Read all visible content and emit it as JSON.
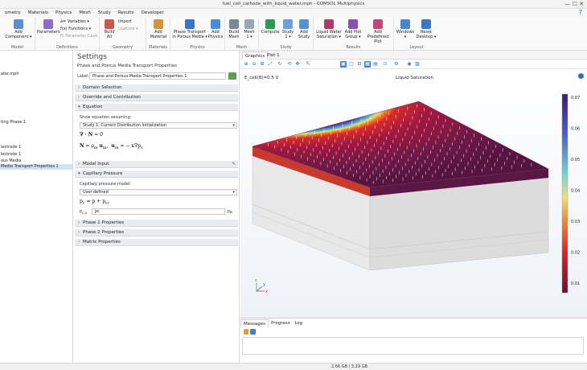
{
  "window": {
    "title": "fuel_cell_cathode_with_liquid_water.mph - COMSOL Multiphysics",
    "controls": "—  ☐  ✕"
  },
  "menu": [
    "ometry",
    "Materials",
    "Physics",
    "Mesh",
    "Study",
    "Results",
    "Developer"
  ],
  "help": "?",
  "ribbon": {
    "model": {
      "label": "Model",
      "component": "Add\nComponent ▾"
    },
    "definitions": {
      "label": "Definitions",
      "parameters": "Parameters",
      "variables": "a= Variables ▾",
      "functions": "f(x) Functions ▾",
      "param_case": "P| Parameter Case"
    },
    "geometry": {
      "label": "Geometry",
      "build_all": "Build\nAll",
      "import": "Import",
      "livelink": "LiveLink ▾"
    },
    "materials": {
      "label": "Materials",
      "add_material": "Add\nMaterial"
    },
    "physics": {
      "label": "Physics",
      "phase_transport": "Phase Transport\nin Porous Media ▾",
      "add_physics": "Add\nPhysics"
    },
    "mesh": {
      "label": "Mesh",
      "build_mesh": "Build\nMesh",
      "mesh1": "Mesh\n1 ▾"
    },
    "study": {
      "label": "Study",
      "compute": "Compute",
      "study1": "Study\n1 ▾",
      "add_study": "Add\nStudy"
    },
    "results": {
      "label": "Results",
      "liquid_water": "Liquid Water\nSaturation ▾",
      "add_plot": "Add Plot\nGroup ▾",
      "add_predef": "Add\nPredefined Plot"
    },
    "layout": {
      "label": "Layout",
      "windows": "Windows\n▾",
      "reset": "Reset\nDesktop ▾"
    }
  },
  "tree": [
    {
      "text": "ater.mph",
      "selected": false
    },
    {
      "text": "ting Phase 1",
      "selected": false
    },
    {
      "text": "lectrode 1",
      "selected": false
    },
    {
      "text": "lectrode 1",
      "selected": false
    },
    {
      "text": "ous Media",
      "selected": false
    },
    {
      "text": "Media Transport Properties 1",
      "selected": true
    }
  ],
  "settings": {
    "heading": "Settings",
    "subtitle": "Phase and Porous Media Transport Properties",
    "label_caption": "Label:",
    "label_value": "Phase and Porous Media Transport Properties 1",
    "sections": {
      "domain_selection": "Domain Selection",
      "override": "Override and Contribution",
      "equation": "Equation",
      "model_input": "Model Input",
      "capillary": "Capillary Pressure",
      "phase1": "Phase 1 Properties",
      "phase2": "Phase 2 Properties",
      "matrix": "Matrix Properties"
    },
    "show_equation": "Show equation assuming:",
    "study_choice": "Study 1, Current Distribution Initialization",
    "eq1": "∇ · N",
    "eq1_rhs": "= 0",
    "eq2": "N",
    "eq2_rhs": "= ρ",
    "eq2_mid": "u",
    "eq2_tail": "κ∇p",
    "cap_model_label": "Capillary pressure model:",
    "cap_model": "User defined",
    "pc_eq": "p",
    "pc_rhs": "= p + p",
    "pc_input_label": "p",
    "pc_input_value": "pc",
    "pc_unit": "Pa"
  },
  "graphics": {
    "tabs": [
      "Graphics",
      "Plot 1"
    ],
    "title_left": "E_cell(8)=0.5 V",
    "title_right": "Liquid Saturation",
    "colorbar_ticks": [
      "0.07",
      "0.06",
      "0.05",
      "0.04",
      "0.03",
      "0.02",
      "0.01"
    ]
  },
  "messages": {
    "tabs": [
      "Messages",
      "Progress",
      "Log"
    ]
  },
  "status": "2.66 GB | 3.29 GB"
}
